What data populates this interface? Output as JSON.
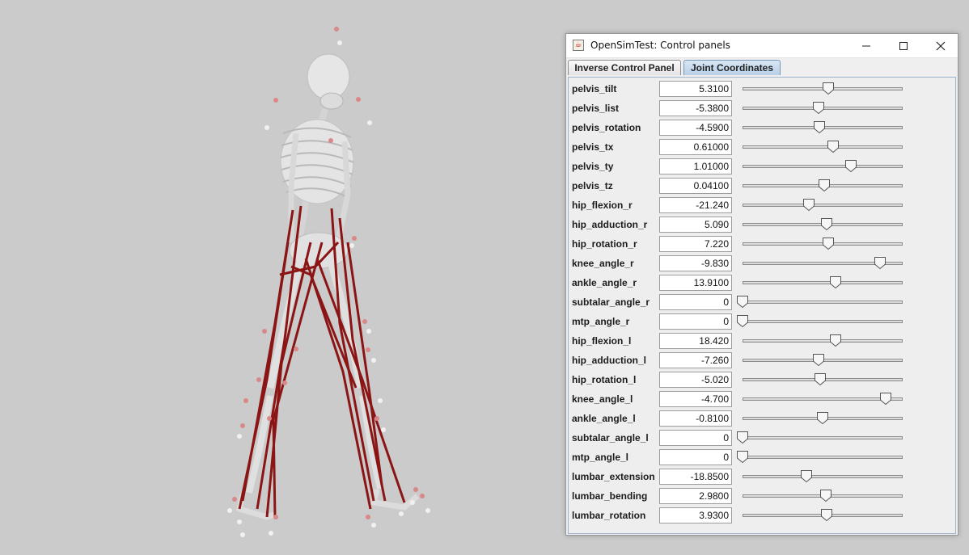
{
  "window": {
    "title": "OpenSimTest: Control panels",
    "icon": "java-cup-icon",
    "buttons": [
      "minimize-icon",
      "maximize-icon",
      "close-icon"
    ]
  },
  "tabs": [
    {
      "label": "Inverse Control Panel",
      "selected": false
    },
    {
      "label": "Joint Coordinates",
      "selected": true
    }
  ],
  "coordinates": [
    {
      "name": "pelvis_tilt",
      "value": "5.3100",
      "slider_fraction": 0.535
    },
    {
      "name": "pelvis_list",
      "value": "-5.3800",
      "slider_fraction": 0.475
    },
    {
      "name": "pelvis_rotation",
      "value": "-4.5900",
      "slider_fraction": 0.48
    },
    {
      "name": "pelvis_tx",
      "value": "0.61000",
      "slider_fraction": 0.565
    },
    {
      "name": "pelvis_ty",
      "value": "1.01000",
      "slider_fraction": 0.675
    },
    {
      "name": "pelvis_tz",
      "value": "0.04100",
      "slider_fraction": 0.51
    },
    {
      "name": "hip_flexion_r",
      "value": "-21.240",
      "slider_fraction": 0.415
    },
    {
      "name": "hip_adduction_r",
      "value": "5.090",
      "slider_fraction": 0.525
    },
    {
      "name": "hip_rotation_r",
      "value": "7.220",
      "slider_fraction": 0.535
    },
    {
      "name": "knee_angle_r",
      "value": "-9.830",
      "slider_fraction": 0.86
    },
    {
      "name": "ankle_angle_r",
      "value": "13.9100",
      "slider_fraction": 0.58
    },
    {
      "name": "subtalar_angle_r",
      "value": "0",
      "slider_fraction": 0.0
    },
    {
      "name": "mtp_angle_r",
      "value": "0",
      "slider_fraction": 0.0
    },
    {
      "name": "hip_flexion_l",
      "value": "18.420",
      "slider_fraction": 0.58
    },
    {
      "name": "hip_adduction_l",
      "value": "-7.260",
      "slider_fraction": 0.475
    },
    {
      "name": "hip_rotation_l",
      "value": "-5.020",
      "slider_fraction": 0.485
    },
    {
      "name": "knee_angle_l",
      "value": "-4.700",
      "slider_fraction": 0.895
    },
    {
      "name": "ankle_angle_l",
      "value": "-0.8100",
      "slider_fraction": 0.5
    },
    {
      "name": "subtalar_angle_l",
      "value": "0",
      "slider_fraction": 0.0
    },
    {
      "name": "mtp_angle_l",
      "value": "0",
      "slider_fraction": 0.0
    },
    {
      "name": "lumbar_extension",
      "value": "-18.8500",
      "slider_fraction": 0.4
    },
    {
      "name": "lumbar_bending",
      "value": "2.9800",
      "slider_fraction": 0.52
    },
    {
      "name": "lumbar_rotation",
      "value": "3.9300",
      "slider_fraction": 0.525
    }
  ],
  "colors": {
    "viewport_bg": "#cbcbcb",
    "muscle": "#8b1414",
    "bone": "#e2e2e2",
    "marker": "#d98888",
    "tab_selected": "#c6d8ec"
  }
}
